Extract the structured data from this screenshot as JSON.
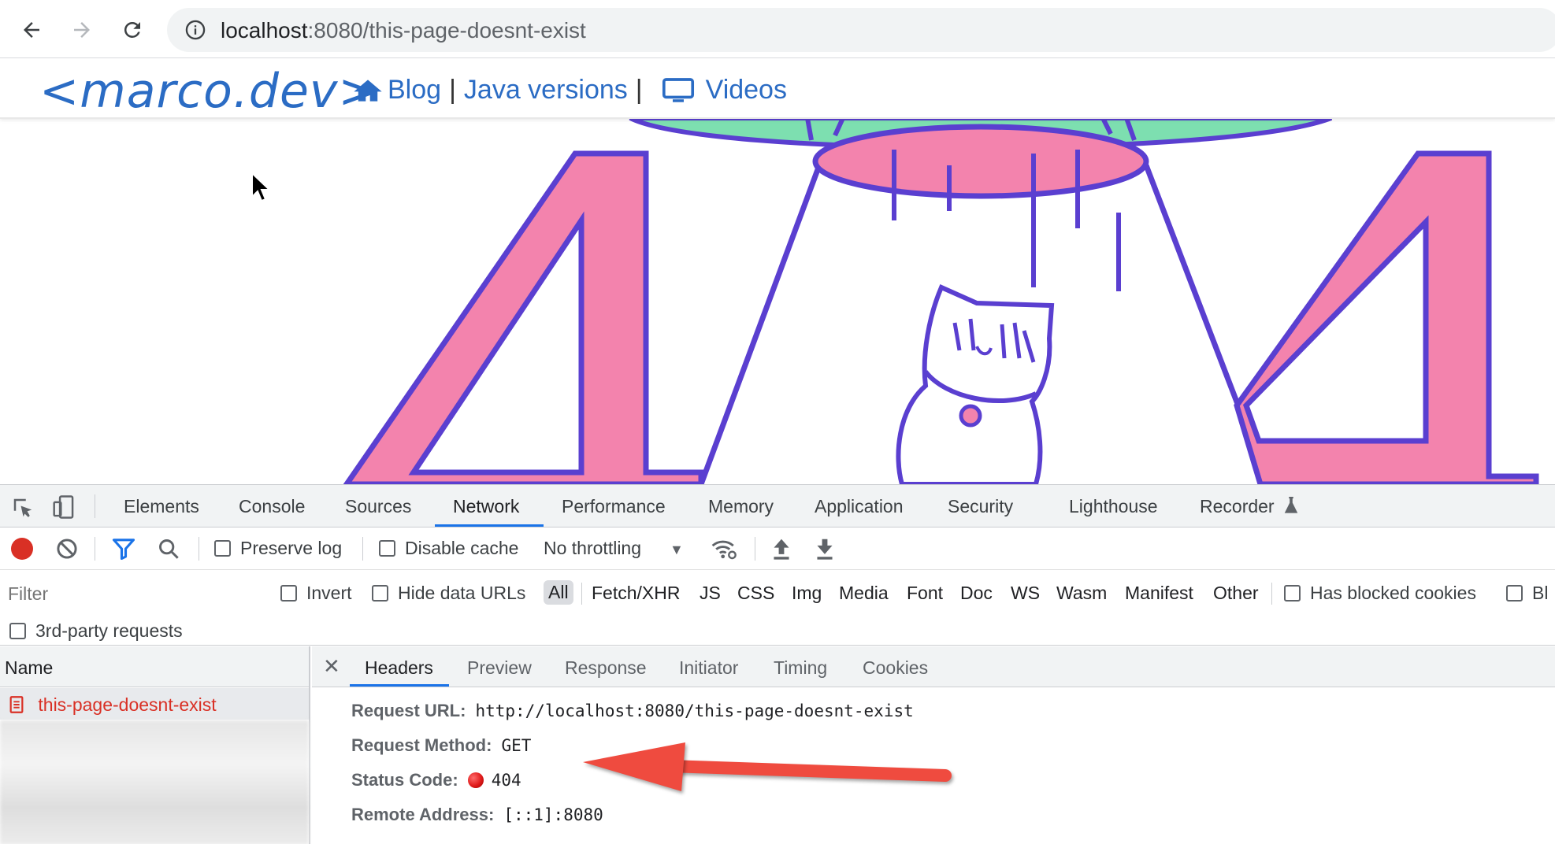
{
  "browser": {
    "url_host": "localhost",
    "url_path": ":8080/this-page-doesnt-exist"
  },
  "site": {
    "logo": "<marco.dev>",
    "nav": {
      "blog": "Blog",
      "separator": "|",
      "java_versions": "Java versions",
      "videos": "Videos"
    }
  },
  "devtools": {
    "panels": [
      "Elements",
      "Console",
      "Sources",
      "Network",
      "Performance",
      "Memory",
      "Application",
      "Security",
      "Lighthouse",
      "Recorder"
    ],
    "active_panel": "Network",
    "toolbar": {
      "preserve_log": "Preserve log",
      "disable_cache": "Disable cache",
      "throttling": "No throttling"
    },
    "filter": {
      "placeholder": "Filter",
      "invert": "Invert",
      "hide_data_urls": "Hide data URLs",
      "types": [
        "All",
        "Fetch/XHR",
        "JS",
        "CSS",
        "Img",
        "Media",
        "Font",
        "Doc",
        "WS",
        "Wasm",
        "Manifest",
        "Other"
      ],
      "has_blocked_cookies": "Has blocked cookies",
      "blocked_truncated": "Bl",
      "third_party": "3rd-party requests"
    },
    "request_list": {
      "header": "Name",
      "rows": [
        "this-page-doesnt-exist"
      ]
    },
    "detail_tabs": [
      "Headers",
      "Preview",
      "Response",
      "Initiator",
      "Timing",
      "Cookies"
    ],
    "active_detail_tab": "Headers",
    "headers": {
      "request_url_label": "Request URL:",
      "request_url": "http://localhost:8080/this-page-doesnt-exist",
      "request_method_label": "Request Method:",
      "request_method": "GET",
      "status_code_label": "Status Code:",
      "status_code": "404",
      "remote_address_label": "Remote Address:",
      "remote_address": "[::1]:8080"
    }
  },
  "colors": {
    "link_blue": "#2b6cc4",
    "illustration_pink": "#f383ad",
    "illustration_purple": "#5a3fd0",
    "illustration_green": "#7ddfb0",
    "arrow_red": "#ef4b3f",
    "devtools_active_blue": "#1a73e8"
  }
}
